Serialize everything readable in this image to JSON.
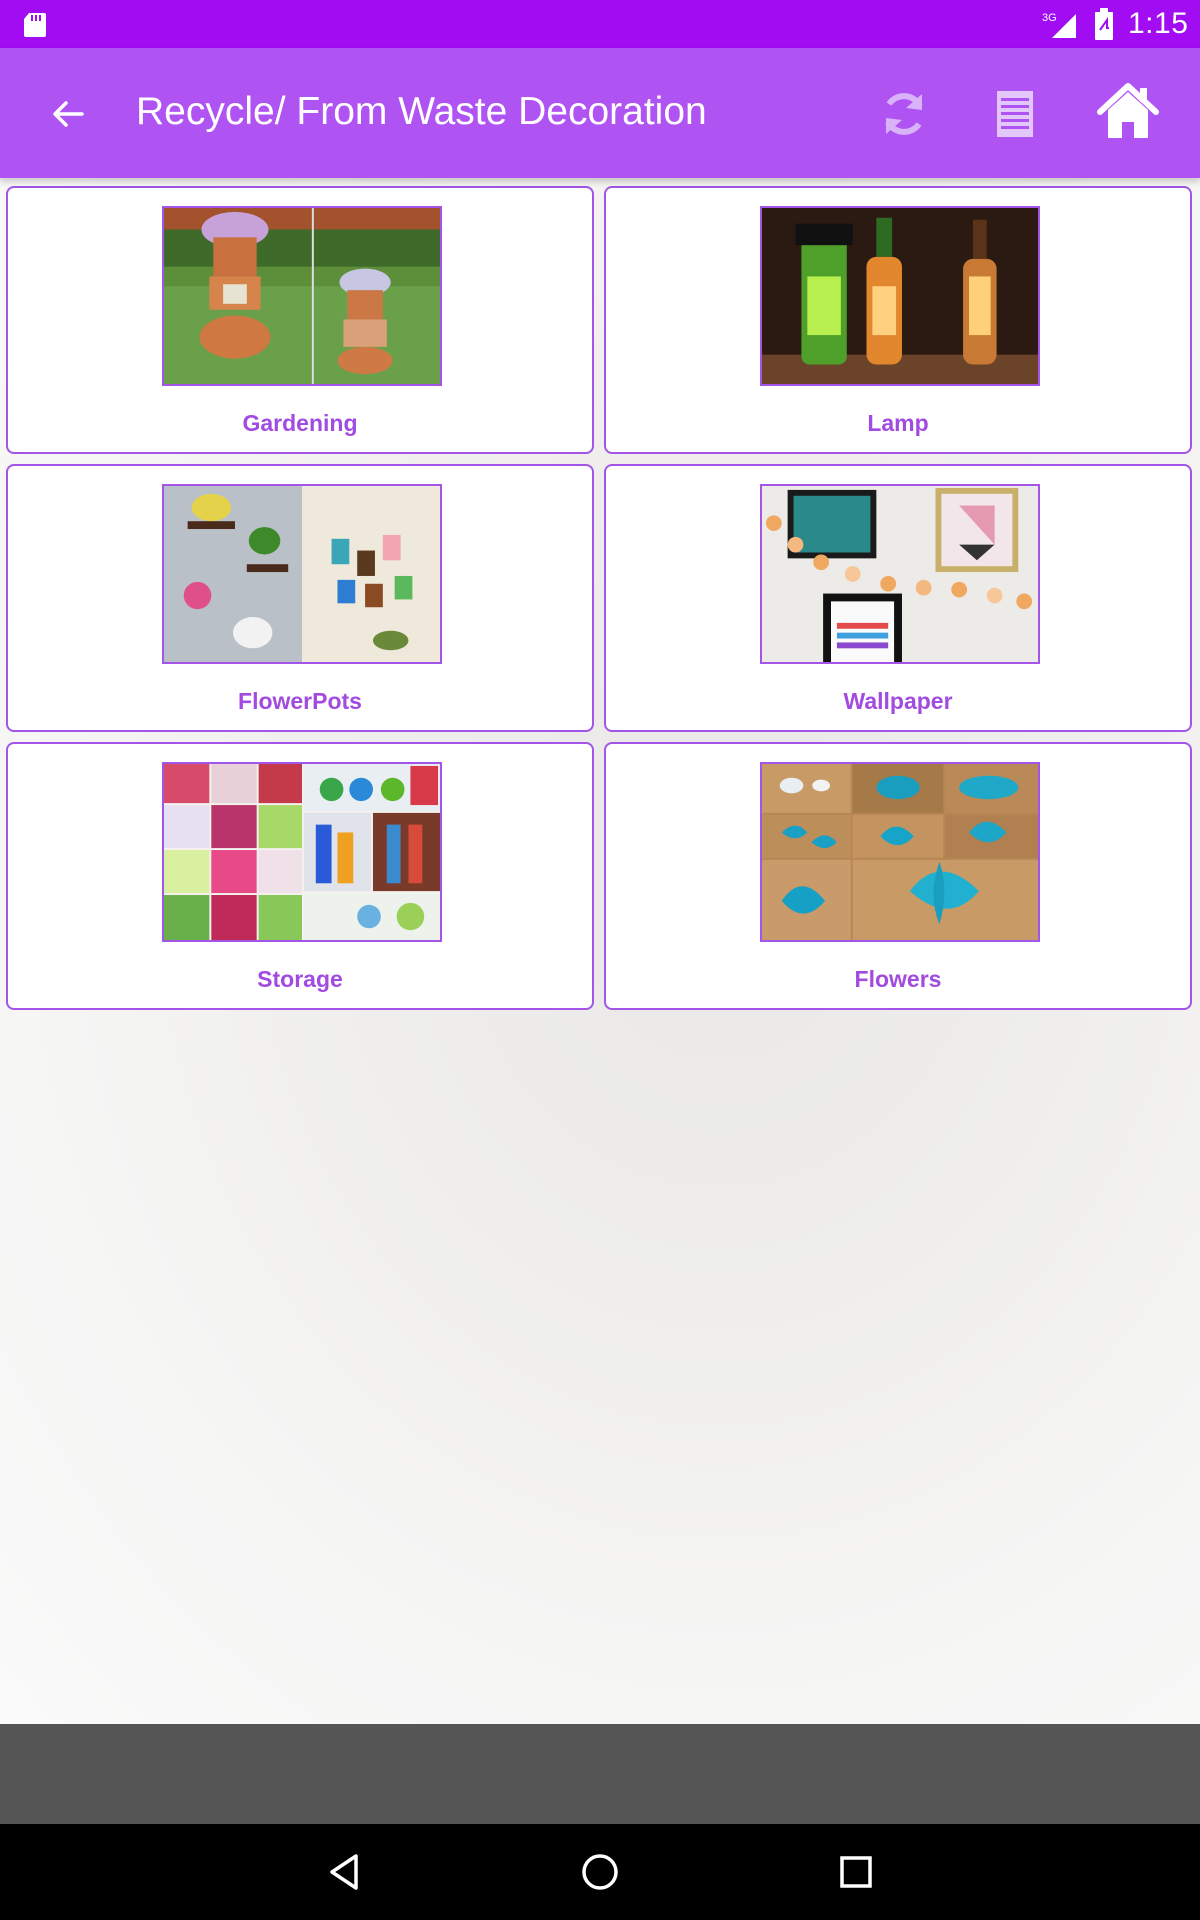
{
  "status_bar": {
    "time": "1:15",
    "network": "3G",
    "icons": [
      "sd-card-icon",
      "signal-icon",
      "battery-icon"
    ]
  },
  "app_bar": {
    "title": "Recycle/ From Waste Decoration",
    "icons": [
      "back-arrow-icon",
      "refresh-icon",
      "list-icon",
      "home-icon"
    ],
    "color": "#b053f3"
  },
  "categories": [
    {
      "label": "Gardening"
    },
    {
      "label": "Lamp"
    },
    {
      "label": "FlowerPots"
    },
    {
      "label": "Wallpaper"
    },
    {
      "label": "Storage"
    },
    {
      "label": "Flowers"
    }
  ],
  "nav_bar": {
    "icons": [
      "nav-back-icon",
      "nav-home-icon",
      "nav-recents-icon"
    ]
  },
  "colors": {
    "status_bar": "#a10cf2",
    "app_bar": "#b053f3",
    "accent": "#a255e6",
    "label": "#a14be0"
  }
}
